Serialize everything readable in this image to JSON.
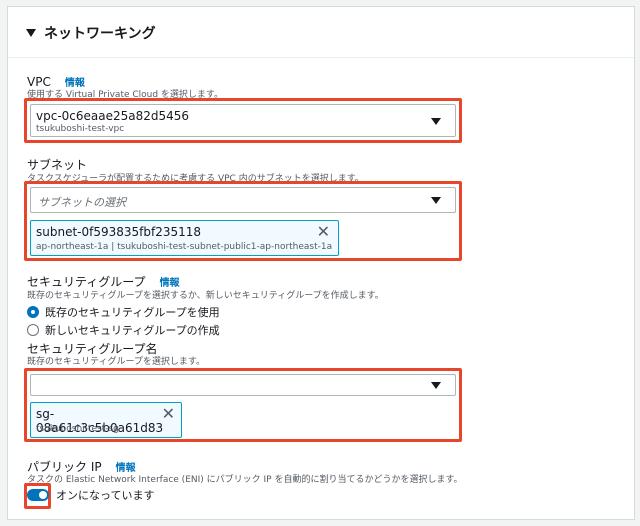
{
  "section": {
    "title": "ネットワーキング"
  },
  "vpc": {
    "label": "VPC",
    "info": "情報",
    "description": "使用する Virtual Private Cloud を選択します。",
    "selected_id": "vpc-0c6eaae25a82d5456",
    "selected_name": "tsukuboshi-test-vpc"
  },
  "subnet": {
    "label": "サブネット",
    "description": "タスクスケジューラが配置するために考慮する VPC 内のサブネットを選択します。",
    "placeholder": "サブネットの選択",
    "token_id": "subnet-0f593835fbf235118",
    "token_detail": "ap-northeast-1a | tsukuboshi-test-subnet-public1-ap-northeast-1a"
  },
  "security_group": {
    "label": "セキュリティグループ",
    "info": "情報",
    "description": "既存のセキュリティグループを選択するか、新しいセキュリティグループを作成します。",
    "radio_existing": "既存のセキュリティグループを使用",
    "radio_new": "新しいセキュリティグループの作成",
    "name_label": "セキュリティグループ名",
    "name_description": "既存のセキュリティグループを選択します。",
    "token_id": "sg-08a61c3c5b0a61d83",
    "token_name": "tsukuboshi-test-sg"
  },
  "public_ip": {
    "label": "パブリック IP",
    "info": "情報",
    "description": "タスクの Elastic Network Interface (ENI) にパブリック IP を自動的に割り当てるかどうかを選択します。",
    "toggle_label": "オンになっています",
    "enabled": true
  },
  "colors": {
    "highlight": "#e8462c",
    "accent": "#0073bb",
    "token_border": "#00a1c9"
  },
  "icons": [
    "caret-down-icon",
    "dropdown-arrow-icon",
    "close-icon",
    "radio-icon",
    "toggle-icon"
  ]
}
